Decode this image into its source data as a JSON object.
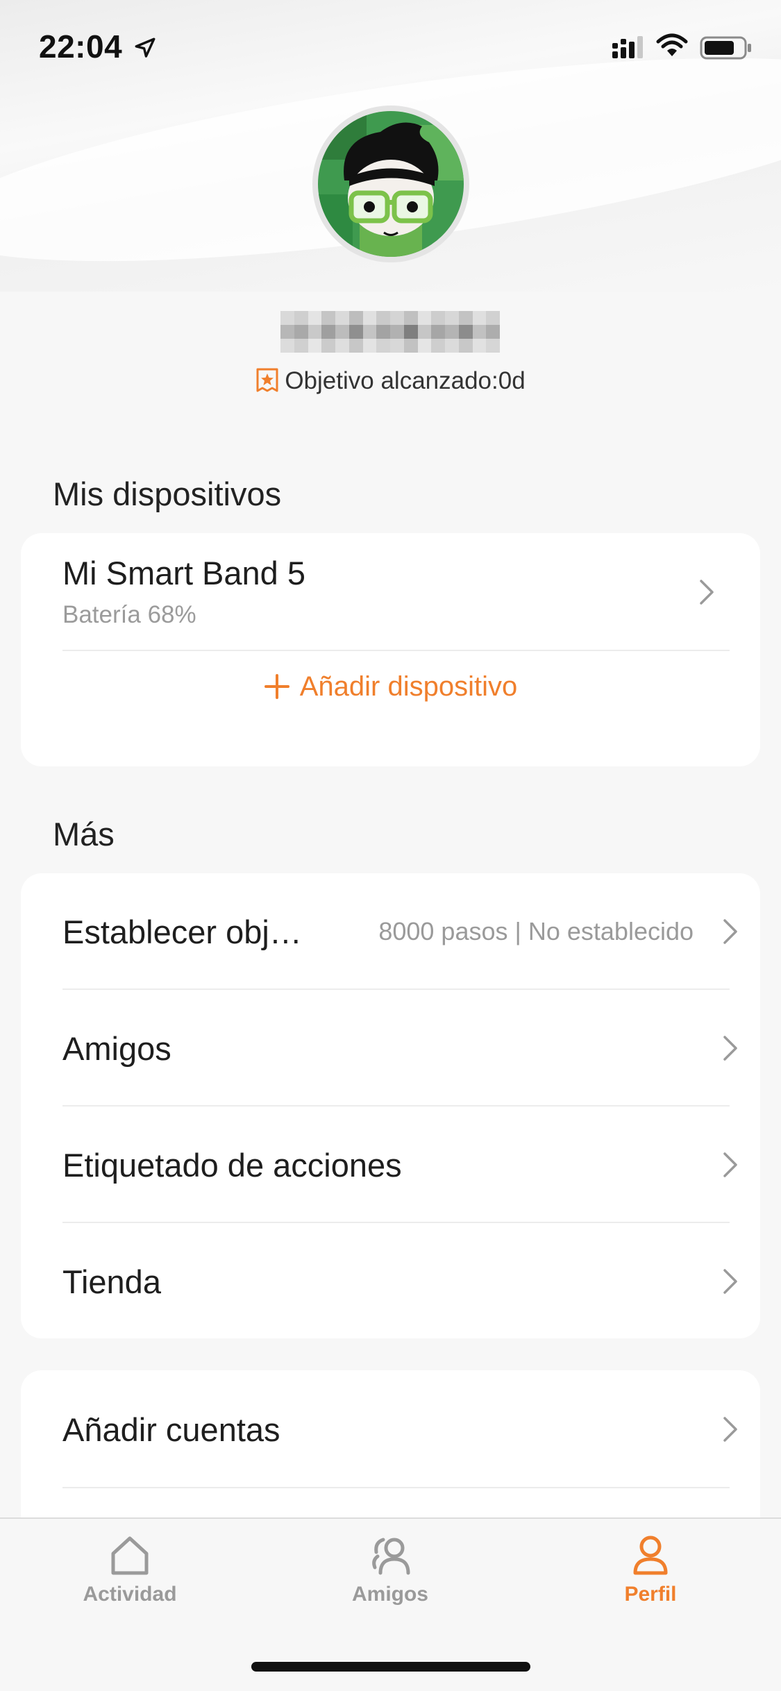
{
  "status_bar": {
    "time": "22:04",
    "icons": [
      "location-arrow-icon",
      "signal-icon",
      "wifi-icon",
      "battery-icon"
    ]
  },
  "profile": {
    "goal_text": "Objetivo alcanzado:0d",
    "goal_icon": "goal-badge-icon"
  },
  "devices": {
    "section_title": "Mis dispositivos",
    "items": [
      {
        "name": "Mi Smart Band 5",
        "battery": "Batería 68%"
      }
    ],
    "add_label": "Añadir dispositivo"
  },
  "more": {
    "section_title": "Más",
    "items": [
      {
        "label": "Establecer obj…",
        "value": "8000 pasos | No establecido"
      },
      {
        "label": "Amigos",
        "value": ""
      },
      {
        "label": "Etiquetado de acciones",
        "value": ""
      },
      {
        "label": "Tienda",
        "value": ""
      }
    ]
  },
  "accounts": {
    "items": [
      {
        "label": "Añadir cuentas"
      }
    ]
  },
  "tab_bar": {
    "tabs": [
      {
        "label": "Actividad",
        "icon": "home-icon",
        "active": false
      },
      {
        "label": "Amigos",
        "icon": "friends-icon",
        "active": false
      },
      {
        "label": "Perfil",
        "icon": "profile-icon",
        "active": true
      }
    ]
  },
  "colors": {
    "accent": "#f07f2c",
    "inactive_tab": "#9a9a9a",
    "background": "#f7f7f7",
    "card": "#ffffff"
  }
}
